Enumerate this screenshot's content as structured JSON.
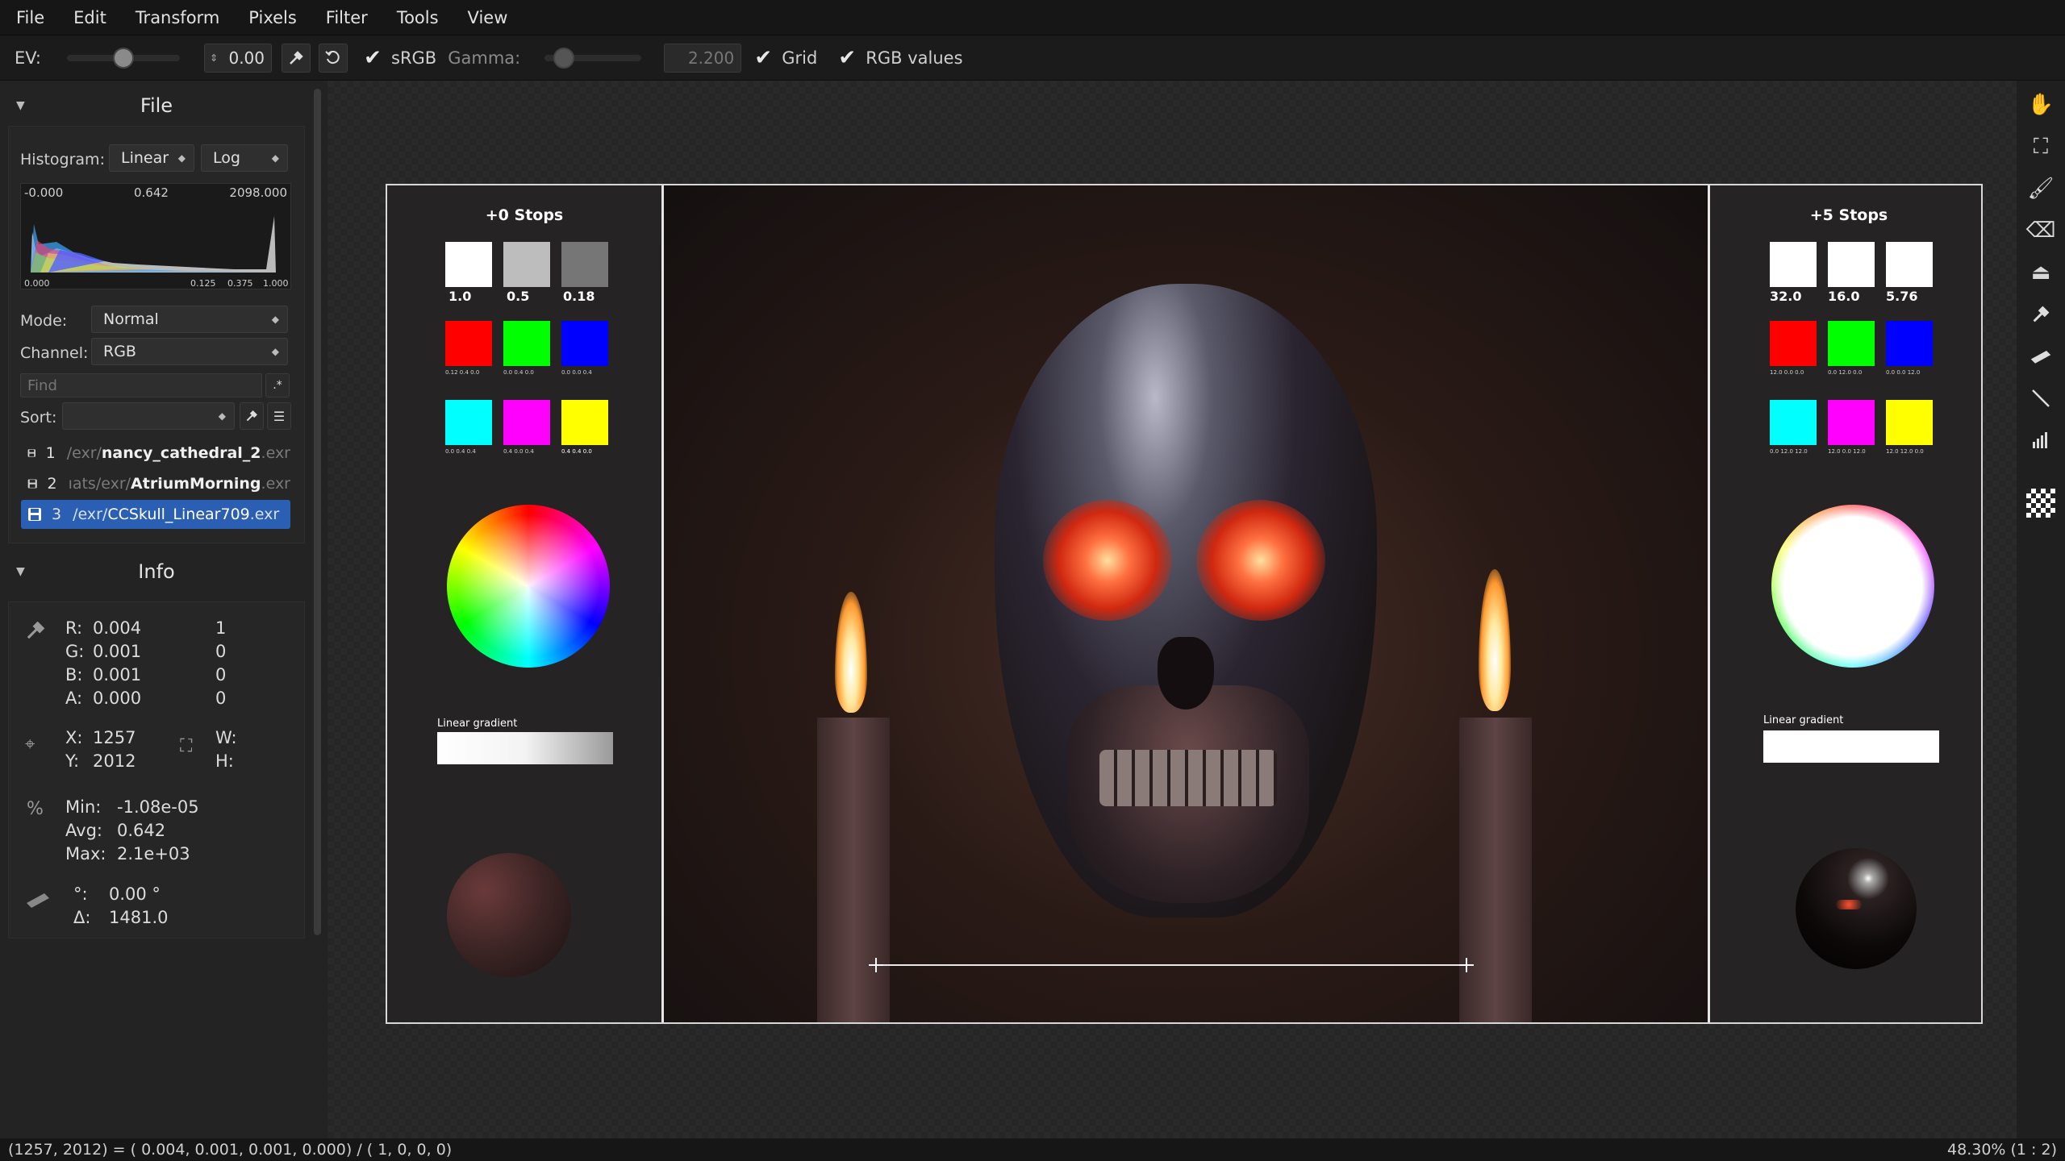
{
  "menu": [
    "File",
    "Edit",
    "Transform",
    "Pixels",
    "Filter",
    "Tools",
    "View"
  ],
  "toolbar": {
    "ev_label": "EV:",
    "ev_value": "0.00",
    "ev_level": 0.5,
    "srgb_label": "sRGB",
    "gamma_label": "Gamma:",
    "gamma_value": "2.200",
    "gamma_level": 0.2,
    "grid_label": "Grid",
    "rgb_values_label": "RGB values"
  },
  "file_panel": {
    "title": "File",
    "histogram_label": "Histogram:",
    "hist_mode_1": "Linear",
    "hist_mode_2": "Log",
    "hist_min": "-0.000",
    "hist_avg": "0.642",
    "hist_max": "2098.000",
    "hist_ticks": [
      "0.000",
      "0.125",
      "0.375",
      "1.000"
    ],
    "mode_label": "Mode:",
    "mode_value": "Normal",
    "channel_label": "Channel:",
    "channel_value": "RGB",
    "find_placeholder": "Find",
    "regex_label": ".*",
    "sort_label": "Sort:",
    "files": [
      {
        "num": "1",
        "path": "/exr/",
        "name": "nancy_cathedral_2",
        "ext": ".exr",
        "selected": false
      },
      {
        "num": "2",
        "path": "ıats/exr/",
        "name": "AtriumMorning",
        "ext": ".exr",
        "selected": false
      },
      {
        "num": "3",
        "path": "/exr/",
        "name": "CCSkull_Linear709",
        "ext": ".exr",
        "selected": true
      }
    ]
  },
  "info_panel": {
    "title": "Info",
    "pixel": {
      "r_label": "R:",
      "r": "0.004",
      "r2": "1",
      "g_label": "G:",
      "g": "0.001",
      "g2": "0",
      "b_label": "B:",
      "b": "0.001",
      "b2": "0",
      "a_label": "A:",
      "a": "0.000",
      "a2": "0"
    },
    "coords": {
      "x_label": "X:",
      "x": "1257",
      "y_label": "Y:",
      "y": "2012",
      "w_label": "W:",
      "h_label": "H:"
    },
    "stats": {
      "min_label": "Min:",
      "min": "-1.08e-05",
      "avg_label": "Avg:",
      "avg": "0.642",
      "max_label": "Max:",
      "max": "2.1e+03"
    },
    "ruler": {
      "angle_label": "°:",
      "angle": "0.00 °",
      "delta_label": "Δ:",
      "delta": "1481.0"
    }
  },
  "image": {
    "left_stops": "+0 Stops",
    "right_stops": "+5 Stops",
    "left_gray_labels": [
      "1.0",
      "0.5",
      "0.18"
    ],
    "right_gray_labels": [
      "32.0",
      "16.0",
      "5.76"
    ],
    "tiny_labels_left": [
      "0.12 0.4 0.0",
      "0.0 0.4 0.0",
      "0.0 0.0 0.4",
      "0.0 0.4 0.4",
      "0.4 0.0 0.4",
      "0.4 0.4 0.0"
    ],
    "tiny_labels_right": [
      "12.0 0.0 0.0",
      "0.0 12.0 0.0",
      "0.0 0.0 12.0",
      "0.0 12.0 12.0",
      "12.0 0.0 12.0",
      "12.0 12.0 0.0"
    ],
    "gradient_label": "Linear gradient"
  },
  "status": {
    "left": "(1257, 2012) = ( 0.004,  0.001,  0.001,  0.000) / ( 1,  0,  0,  0)",
    "right": "48.30% (1 : 2)"
  },
  "icons": {
    "pick": "eyedropper-icon",
    "reset": "reset-icon",
    "pan": "hand-icon",
    "fit": "fit-screen-icon"
  }
}
